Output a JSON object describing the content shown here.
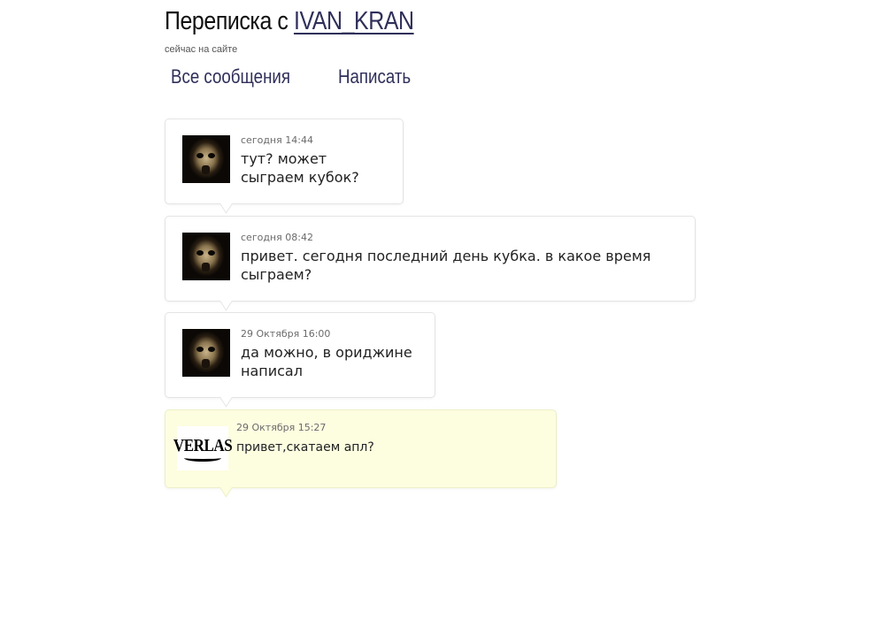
{
  "header": {
    "title_prefix": "Переписка с",
    "username": "IVAN_KRAN",
    "status": "сейчас на сайте"
  },
  "nav": {
    "all_messages": "Все сообщения",
    "write": "Написать"
  },
  "messages": [
    {
      "timestamp": "сегодня 14:44",
      "text": "тут? может сыграем кубок?",
      "author_avatar": "mask-avatar",
      "own": false
    },
    {
      "timestamp": "сегодня 08:42",
      "text": "привет. сегодня последний день кубка. в какое время сыграем?",
      "author_avatar": "mask-avatar",
      "own": false
    },
    {
      "timestamp": "29 Октября 16:00",
      "text": "да можно, в ориджине написал",
      "author_avatar": "mask-avatar",
      "own": false
    },
    {
      "timestamp": "29 Октября 15:27",
      "text": "привет,скатаем апл?",
      "author_avatar": "verlas-logo",
      "own": true,
      "avatar_text": "VERLAS"
    }
  ],
  "colors": {
    "own_bubble": "#fdfde0",
    "link": "#2f2f5a"
  }
}
